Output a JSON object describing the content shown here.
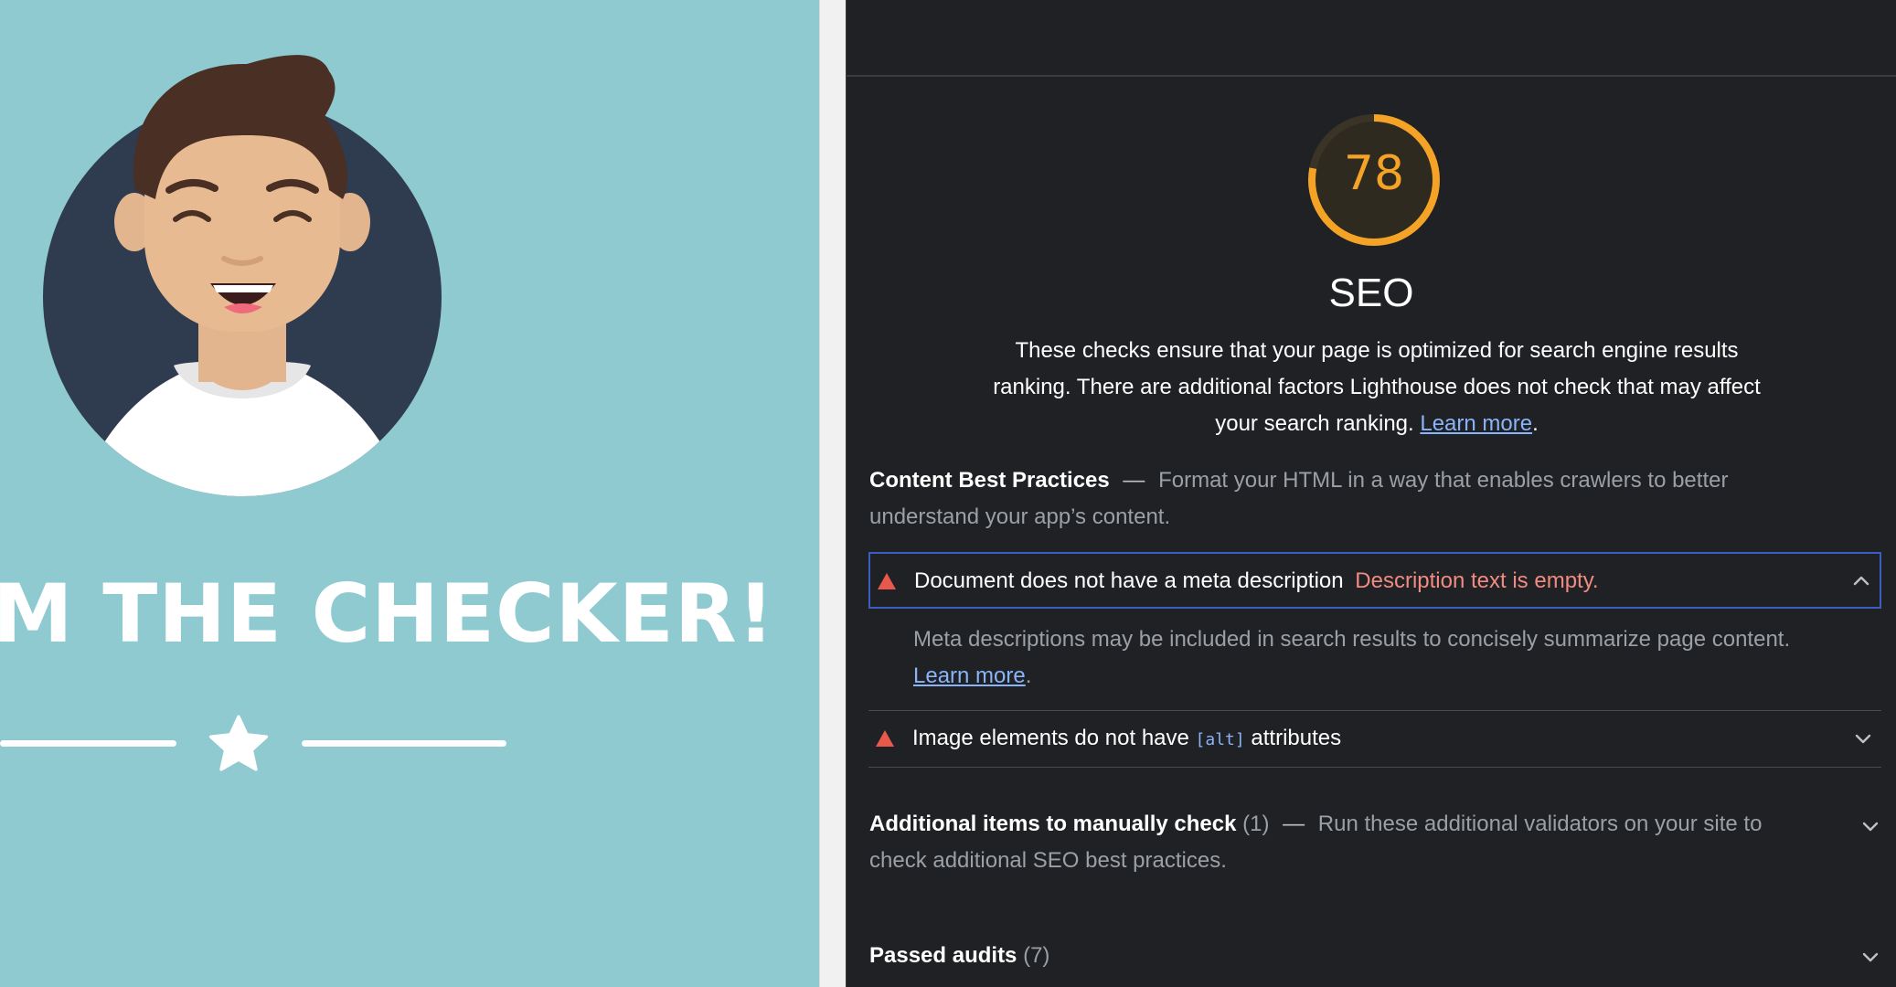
{
  "page_preview": {
    "headline": "M THE CHECKER!"
  },
  "lighthouse": {
    "score": "78",
    "score_fraction": 0.78,
    "category_title": "SEO",
    "description": "These checks ensure that your page is optimized for search engine results ranking. There are additional factors Lighthouse does not check that may affect your search ranking.",
    "description_link": "Learn more",
    "content_group": {
      "title": "Content Best Practices",
      "dash": "—",
      "description": "Format your HTML in a way that enables crawlers to better understand your app’s content."
    },
    "audits": [
      {
        "title": "Document does not have a meta description",
        "error": "Description text is empty.",
        "body": "Meta descriptions may be included in search results to concisely summarize page content.",
        "body_link": "Learn more",
        "expanded": true
      },
      {
        "title_before": "Image elements do not have",
        "code": "[alt]",
        "title_after": "attributes",
        "expanded": false
      }
    ],
    "manual_group": {
      "title": "Additional items to manually check",
      "count": "(1)",
      "dash": "—",
      "description": "Run these additional validators on your site to check additional SEO best practices."
    },
    "passed_group": {
      "title": "Passed audits",
      "count": "(7)"
    }
  },
  "colors": {
    "preview_bg": "#8ecad0",
    "panel_bg": "#202124",
    "score_average": "#f4a327",
    "fail": "#f28b82",
    "link": "#8ab4f8"
  }
}
